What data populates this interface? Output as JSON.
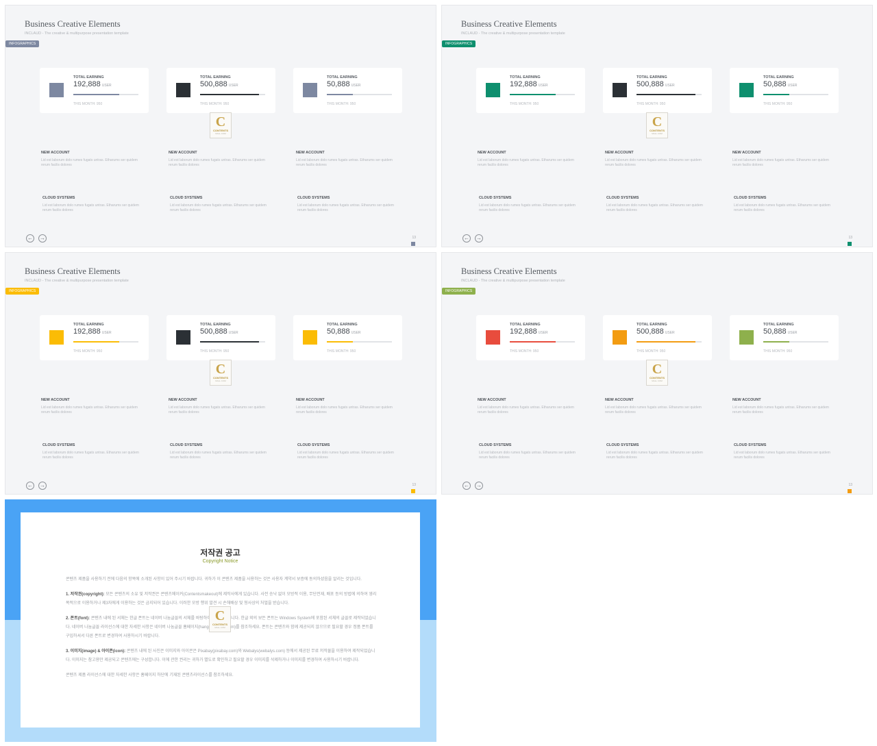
{
  "slides": [
    {
      "title": "Business Creative Elements",
      "subtitle": "INCLAUD - The creative & multipurpose presentation template",
      "tag": "INFOGRAPHICS",
      "tag_color": "#7d88a1",
      "page": "13",
      "page_color": "#7d88a1",
      "cards": [
        {
          "label": "TOTAL EARNING",
          "value": "192,888",
          "unit": "USER",
          "month": "THIS MONTH: 950",
          "progress": 0.7,
          "color": "#7d88a1"
        },
        {
          "label": "TOTAL EARNING",
          "value": "500,888",
          "unit": "USER",
          "month": "THIS MONTH: 950",
          "progress": 0.9,
          "color": "#2b3035"
        },
        {
          "label": "TOTAL EARNING",
          "value": "50,888",
          "unit": "USER",
          "month": "THIS MONTH: 950",
          "progress": 0.4,
          "color": "#7d88a1"
        }
      ]
    },
    {
      "title": "Business Creative Elements",
      "subtitle": "INCLAUD - The creative & multipurpose presentation template",
      "tag": "INFOGRAPHICS",
      "tag_color": "#0e8f6e",
      "page": "13",
      "page_color": "#0e8f6e",
      "cards": [
        {
          "label": "TOTAL EARNING",
          "value": "192,888",
          "unit": "USER",
          "month": "THIS MONTH: 950",
          "progress": 0.7,
          "color": "#0e8f6e"
        },
        {
          "label": "TOTAL EARNING",
          "value": "500,888",
          "unit": "USER",
          "month": "THIS MONTH: 950",
          "progress": 0.9,
          "color": "#2b3035"
        },
        {
          "label": "TOTAL EARNING",
          "value": "50,888",
          "unit": "USER",
          "month": "THIS MONTH: 950",
          "progress": 0.4,
          "color": "#0e8f6e"
        }
      ]
    },
    {
      "title": "Business Creative Elements",
      "subtitle": "INCLAUD - The creative & multipurpose presentation template",
      "tag": "INFOGRAPHICS",
      "tag_color": "#fbbc05",
      "page": "13",
      "page_color": "#fbbc05",
      "cards": [
        {
          "label": "TOTAL EARNING",
          "value": "192,888",
          "unit": "USER",
          "month": "THIS MONTH: 950",
          "progress": 0.7,
          "color": "#fbbc05"
        },
        {
          "label": "TOTAL EARNING",
          "value": "500,888",
          "unit": "USER",
          "month": "THIS MONTH: 950",
          "progress": 0.9,
          "color": "#2b3035"
        },
        {
          "label": "TOTAL EARNING",
          "value": "50,888",
          "unit": "USER",
          "month": "THIS MONTH: 950",
          "progress": 0.4,
          "color": "#fbbc05"
        }
      ]
    },
    {
      "title": "Business Creative Elements",
      "subtitle": "INCLAUD - The creative & multipurpose presentation template",
      "tag": "INFOGRAPHICS",
      "tag_color": "#8eb04c",
      "page": "13",
      "page_color": "#f39c12",
      "cards": [
        {
          "label": "TOTAL EARNING",
          "value": "192,888",
          "unit": "USER",
          "month": "THIS MONTH: 950",
          "progress": 0.7,
          "color": "#e84c3d"
        },
        {
          "label": "TOTAL EARNING",
          "value": "500,888",
          "unit": "USER",
          "month": "THIS MONTH: 950",
          "progress": 0.9,
          "color": "#f39c12"
        },
        {
          "label": "TOTAL EARNING",
          "value": "50,888",
          "unit": "USER",
          "month": "THIS MONTH: 950",
          "progress": 0.4,
          "color": "#8eb04c"
        }
      ]
    }
  ],
  "features": {
    "new_account": {
      "title": "NEW ACCOUNT",
      "text": "Lid est laborum dolo rumes fugats untras. Etharums ser quidem rerum facilis dolores"
    },
    "cloud_systems": {
      "title": "CLOUD SYSTEMS",
      "text": "Lid est laborum dolo rumes fugats untras. Etharums ser quidem rerum facilis dolores"
    }
  },
  "nav": {
    "prev_icon": "arrow-left-circle-icon",
    "next_icon": "arrow-right-circle-icon",
    "prev_glyph": "←",
    "next_glyph": "→"
  },
  "watermark": {
    "letter": "C",
    "text": "CONTENTS",
    "sub": "MALL COM"
  },
  "copyright": {
    "title": "저작권 공고",
    "subtitle": "Copyright Notice",
    "intro": "콘텐츠 제품을 사용하기 전에 다음의 항목에 소개된 사항이 있어 주시기 바랍니다. 귀하가 이 콘텐츠 제품을 사용하는 것은 사용자 계약서 보증에 동의하셨음을 알리는 것입니다.",
    "sections": [
      {
        "heading": "1. 저작권(copyright):",
        "text": "모든 콘텐츠의 소유 및 저작권은 콘텐츠메이커(Contentsmakeout)에 제작사에게 있습니다. 사전 승낙 없이 모방적 이용, 무단전재, 배포 등의 방법에 의하여 영리 목적으로 이용하거나 제3자에게 이용하는 것은 금지되어 있습니다. 이러한 모방 행위 발견 시 손해배상 및 형사상의 처벌을 받습니다."
      },
      {
        "heading": "2. 폰트(font):",
        "text": "콘텐츠 내에 된 서체는 한글 폰트는 네이버 나눔글꼴의 서체를 바탕하여 제작되었습니다. 한글 외의 보든 폰트는 Windows System에 포함된 서체의 글꼴로 제작되었습니다. 네이버 나눔글꼴 라이선스에 대한 자세한 사항은 네이버 나눔글꼴 홈페이지(hangeul.naver.com)를 참조하세요. 폰트는 콘텐츠와 함께 제공되지 않으므로 필요할 경우 정품 폰트를 구입하셔서 다른 폰트로 변경하여 사용하시기 바랍니다."
      },
      {
        "heading": "3. 이미지(image) & 아이콘(icon):",
        "text": "콘텐츠 내에 된 사진은 이미지와 아이콘은 Pixabay(pixabay.com)와 Webalys(webalys.com) 등에서 제공된 무료 저작물을 이용하여 제작되었습니다. 이미지는 참고용만 제공되고 콘텐츠에는 구성합니다. 이에 관한 권리는 귀하가 별도로 확인하고 필요할 경우 이미지를 삭제하거나 이미지를 변경하여 사용하시기 바랍니다."
      }
    ],
    "outro": "콘텐츠 제품 라이선스에 대한 자세한 사항은 홈페이지 하단에 기재된 콘텐츠라이선스를 참조하세요."
  }
}
